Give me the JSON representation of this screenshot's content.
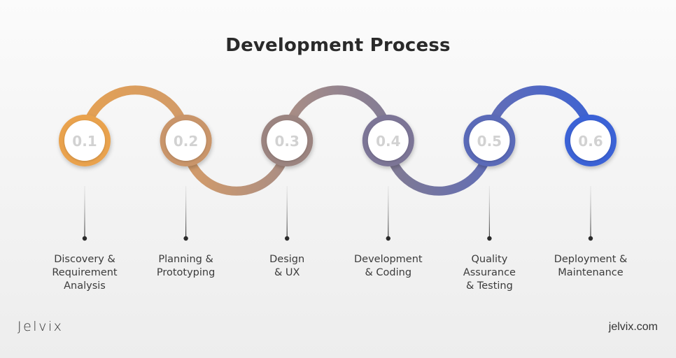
{
  "title": "Development Process",
  "steps": [
    {
      "number": "0.1",
      "label": "Discovery &\nRequirement\nAnalysis",
      "color": "#e9a24e"
    },
    {
      "number": "0.2",
      "label": "Planning &\nPrototyping",
      "color": "#c9956a"
    },
    {
      "number": "0.3",
      "label": "Design\n& UX",
      "color": "#9b8480"
    },
    {
      "number": "0.4",
      "label": "Development\n& Coding",
      "color": "#7b7596"
    },
    {
      "number": "0.5",
      "label": "Quality\nAssurance\n& Testing",
      "color": "#5a6ab8"
    },
    {
      "number": "0.6",
      "label": "Deployment &\nMaintenance",
      "color": "#3a62d6"
    }
  ],
  "footer": {
    "brand": "Jelvix",
    "website": "jelvix.com"
  }
}
